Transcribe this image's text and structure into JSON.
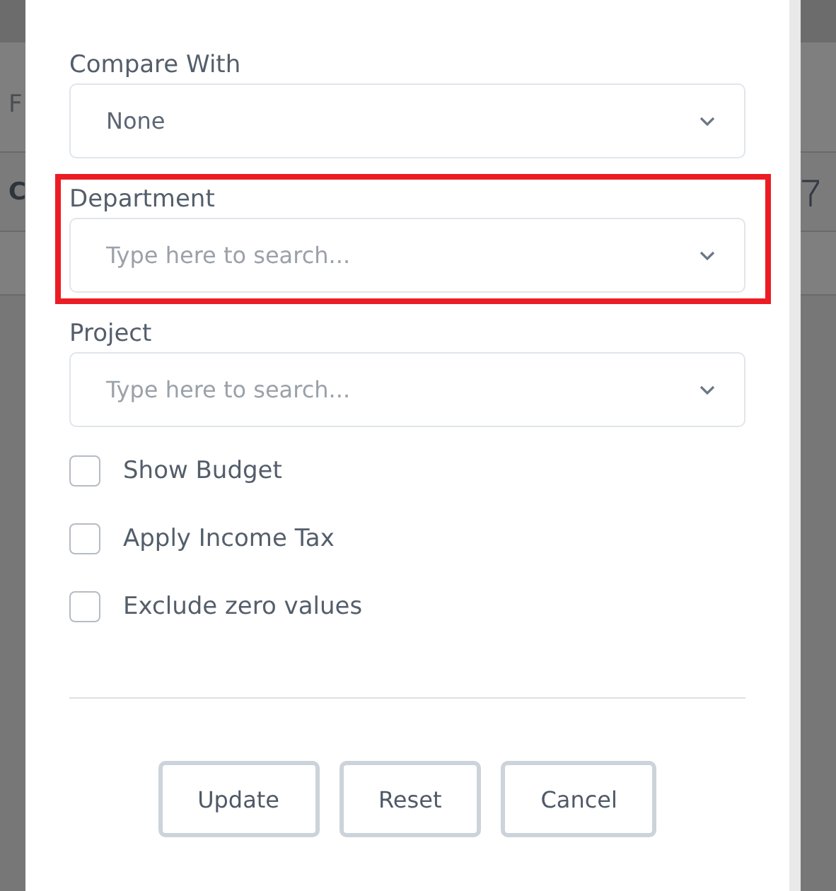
{
  "background": {
    "left_column": [
      "F",
      "C"
    ]
  },
  "fields": [
    {
      "label": "Compare With",
      "value": "None",
      "highlighted": false
    },
    {
      "label": "Department",
      "placeholder": "Type here to search...",
      "highlighted": true
    },
    {
      "label": "Project",
      "placeholder": "Type here to search...",
      "highlighted": false
    }
  ],
  "options": [
    {
      "label": "Show Budget",
      "checked": false
    },
    {
      "label": "Apply Income Tax",
      "checked": false
    },
    {
      "label": "Exclude zero values",
      "checked": false
    }
  ],
  "buttons": [
    "Update",
    "Reset",
    "Cancel"
  ]
}
